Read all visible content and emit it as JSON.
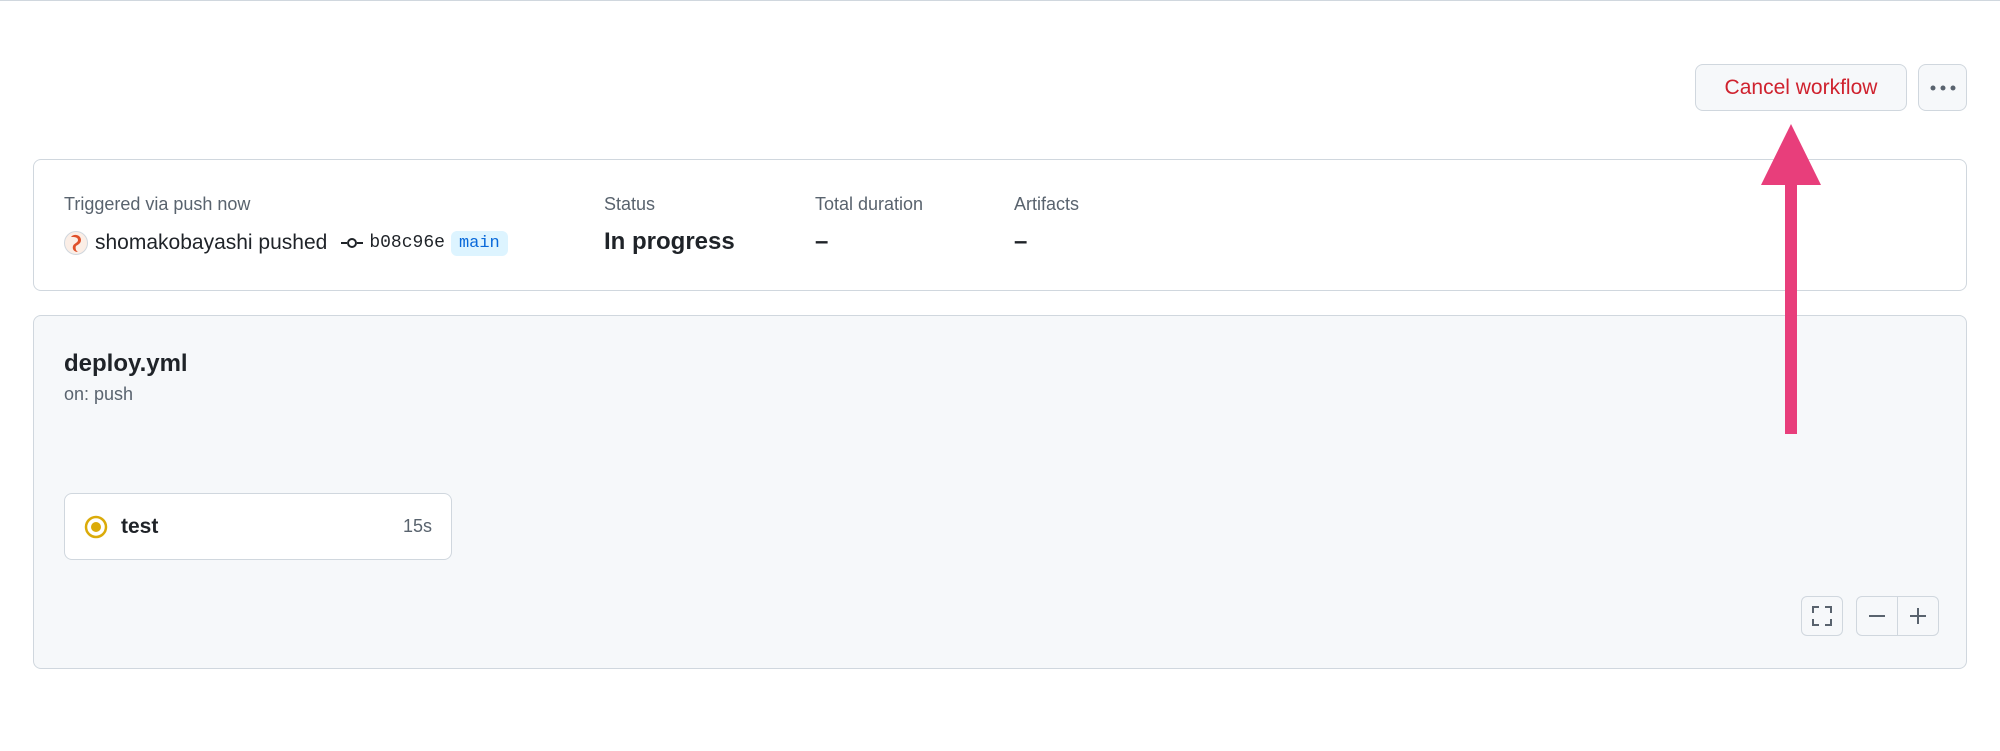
{
  "header": {
    "cancel_label": "Cancel workflow"
  },
  "summary": {
    "trigger_label": "Triggered via push now",
    "actor": "shomakobayashi pushed",
    "commit_sha": "b08c96e",
    "branch": "main",
    "status_label": "Status",
    "status_value": "In progress",
    "duration_label": "Total duration",
    "duration_value": "–",
    "artifacts_label": "Artifacts",
    "artifacts_value": "–"
  },
  "workflow": {
    "name": "deploy.yml",
    "trigger": "on: push",
    "jobs": [
      {
        "name": "test",
        "duration": "15s",
        "status": "in-progress"
      }
    ]
  },
  "icons": [
    "kebab-icon",
    "commit-icon",
    "avatar",
    "in-progress-icon",
    "fullscreen-icon",
    "zoom-out-icon",
    "zoom-in-icon",
    "annotation-arrow"
  ],
  "colors": {
    "danger": "#cf222e",
    "accent": "#0969da",
    "in_progress": "#dbab09",
    "annotation": "#e83e7b"
  }
}
